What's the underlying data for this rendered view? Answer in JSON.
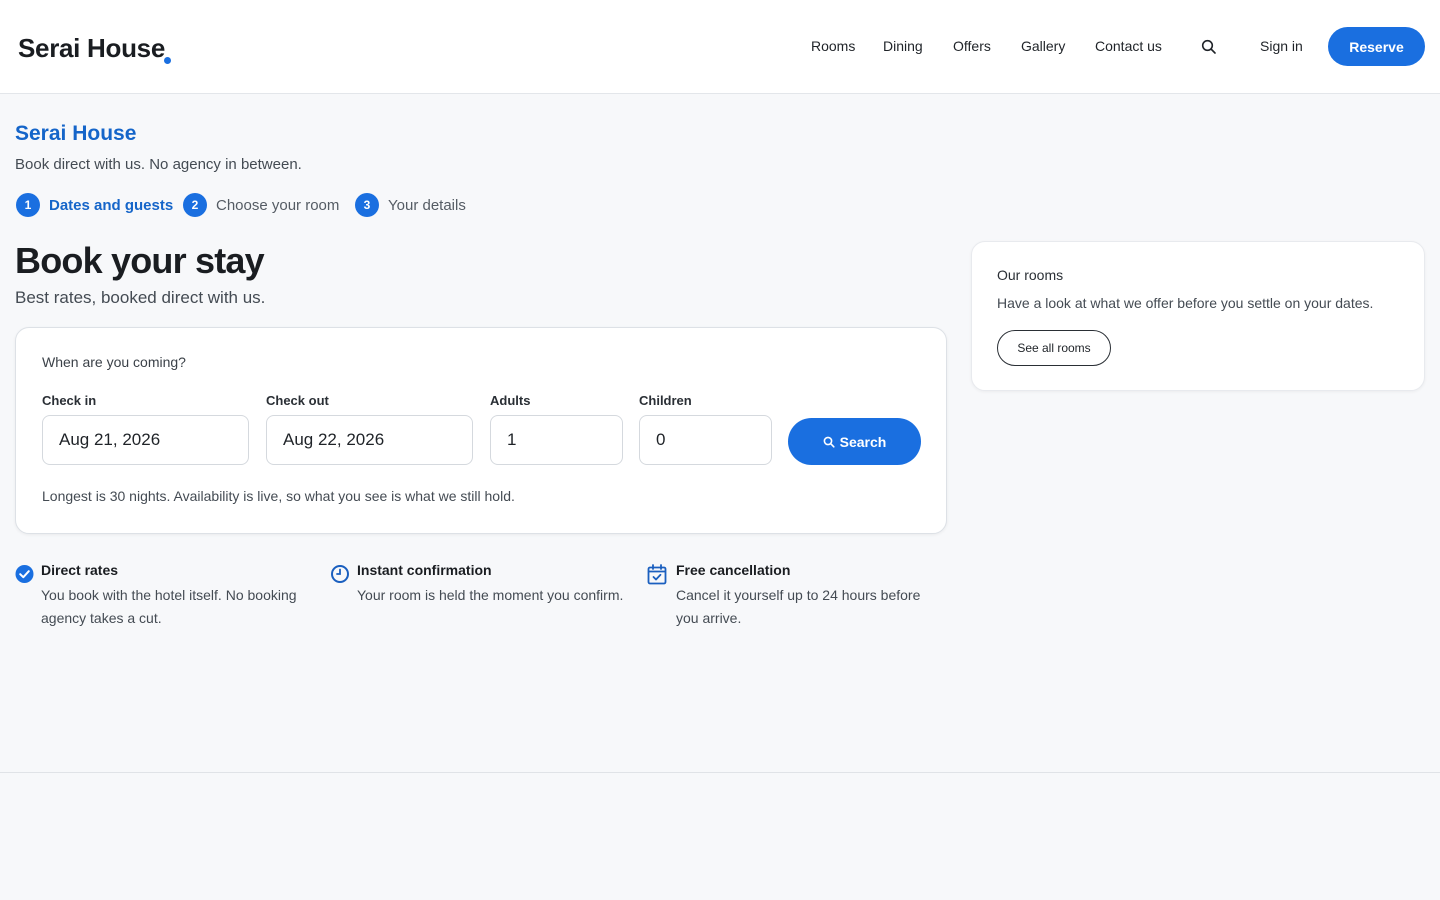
{
  "brand": {
    "name": "Serai House"
  },
  "nav": {
    "items": [
      "Rooms",
      "Dining",
      "Offers",
      "Gallery",
      "Contact us"
    ],
    "signin": "Sign in",
    "reserve": "Reserve"
  },
  "intro": {
    "hotel_name": "Serai House",
    "tagline": "Book direct with us. No agency in between."
  },
  "steps": [
    {
      "num": "1",
      "label": "Dates and guests",
      "active": true
    },
    {
      "num": "2",
      "label": "Choose your room",
      "active": false
    },
    {
      "num": "3",
      "label": "Your details",
      "active": false
    }
  ],
  "booking": {
    "title": "Book your stay",
    "subtitle": "Best rates, booked direct with us.",
    "question": "When are you coming?",
    "checkin_label": "Check in",
    "checkin_value": "Aug 21, 2026",
    "checkout_label": "Check out",
    "checkout_value": "Aug 22, 2026",
    "adults_label": "Adults",
    "adults_value": "1",
    "children_label": "Children",
    "children_value": "0",
    "search_label": "Search",
    "note": "Longest is 30 nights. Availability is live, so what you see is what we still hold."
  },
  "features": [
    {
      "icon": "check-circle-icon",
      "title": "Direct rates",
      "body": "You book with the hotel itself. No booking agency takes a cut."
    },
    {
      "icon": "clock-icon",
      "title": "Instant confirmation",
      "body": "Your room is held the moment you confirm."
    },
    {
      "icon": "calendar-check-icon",
      "title": "Free cancellation",
      "body": "Cancel it yourself up to 24 hours before you arrive."
    }
  ],
  "rooms_card": {
    "title": "Our rooms",
    "description": "Have a look at what we offer before you settle on your dates.",
    "button": "See all rooms"
  },
  "colors": {
    "accent": "#1a6fe0",
    "heading_accent": "#1565c9",
    "background": "#f7f8fa"
  }
}
